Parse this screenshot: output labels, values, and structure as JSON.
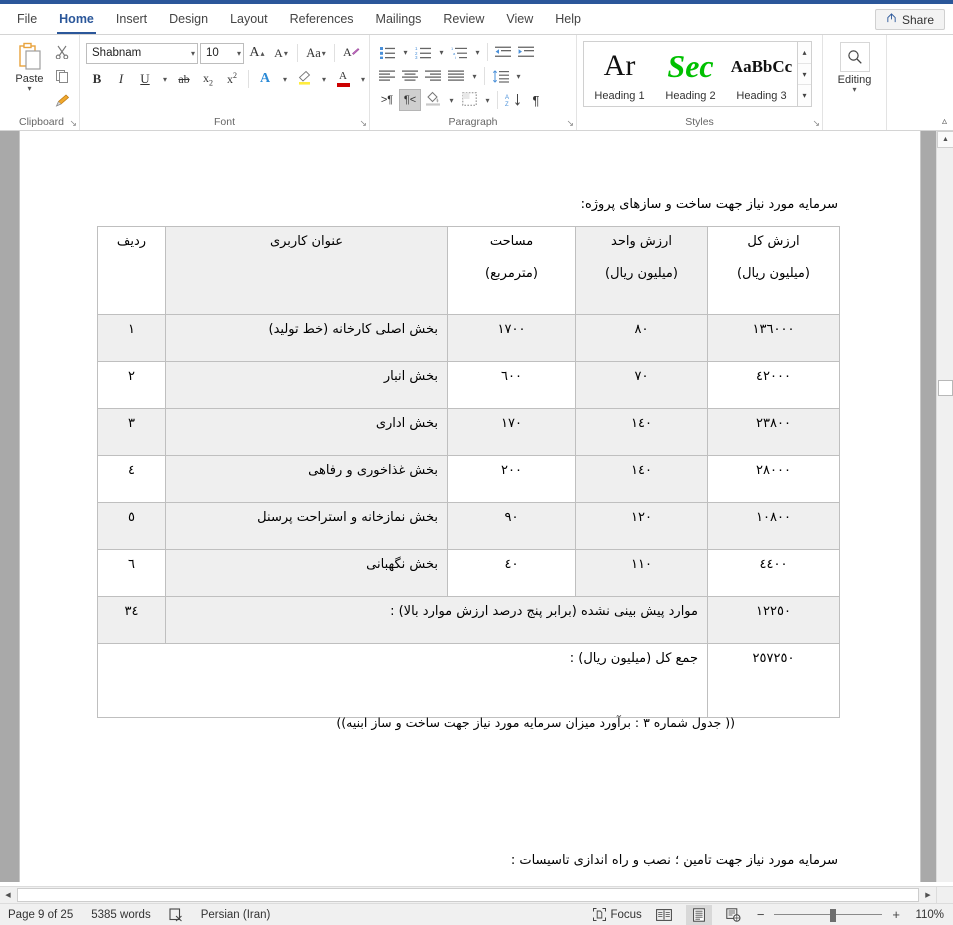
{
  "window": {
    "accent_color": "#2b579a"
  },
  "tabs": [
    {
      "label": "File",
      "active": false
    },
    {
      "label": "Home",
      "active": true
    },
    {
      "label": "Insert",
      "active": false
    },
    {
      "label": "Design",
      "active": false
    },
    {
      "label": "Layout",
      "active": false
    },
    {
      "label": "References",
      "active": false
    },
    {
      "label": "Mailings",
      "active": false
    },
    {
      "label": "Review",
      "active": false
    },
    {
      "label": "View",
      "active": false
    },
    {
      "label": "Help",
      "active": false
    }
  ],
  "share": {
    "label": "Share"
  },
  "ribbon": {
    "clipboard": {
      "label": "Clipboard",
      "paste_label": "Paste",
      "cut_title": "Cut",
      "copy_title": "Copy",
      "format_painter_title": "Format Painter"
    },
    "font": {
      "label": "Font",
      "font_name": "Shabnam",
      "font_size": "10",
      "grow_font": "A",
      "shrink_font": "A",
      "change_case": "Aa",
      "clear_formatting": "A",
      "bold": "B",
      "italic": "I",
      "underline": "U",
      "strikethrough": "ab",
      "subscript": "x",
      "subscript_idx": "2",
      "superscript": "x",
      "superscript_idx": "2",
      "text_effects": "A",
      "highlight": "A",
      "font_color": "A"
    },
    "paragraph": {
      "label": "Paragraph",
      "bullets_title": "Bullets",
      "numbering_title": "Numbering",
      "multilevel_title": "Multilevel List",
      "decrease_indent_title": "Decrease Indent",
      "increase_indent_title": "Increase Indent",
      "align_left_title": "Align Left",
      "center_title": "Center",
      "align_right_title": "Align Right",
      "justify_title": "Justify",
      "line_spacing_title": "Line and Paragraph Spacing",
      "ltr_title": "Left-to-Right Text Direction",
      "rtl_title": "Right-to-Left Text Direction",
      "shading_title": "Shading",
      "borders_title": "Borders",
      "sort_title": "Sort",
      "marks_title": "Show/Hide Formatting Marks",
      "pilcrow": "¶"
    },
    "styles": {
      "label": "Styles",
      "items": [
        {
          "preview": "Ar",
          "name": "Heading 1"
        },
        {
          "preview": "Sec",
          "name": "Heading 2"
        },
        {
          "preview": "AaBbCc",
          "name": "Heading 3"
        }
      ]
    },
    "editing": {
      "label": "Editing",
      "find_title": "Find"
    }
  },
  "document": {
    "intro_text": "سرمایه مورد نیاز جهت ساخت و سازهای پروژه:",
    "caption_text": "(( جدول شماره ٣ : برآورد میزان سرمایه مورد نیاز جهت ساخت و ساز ابنیه))",
    "bottom_text": "سرمایه مورد نیاز جهت تامین ؛ نصب و راه اندازی تاسیسات :",
    "table": {
      "headers": {
        "radif": "ردیف",
        "title": "عنوان کاربری",
        "area_l1": "مساحت",
        "area_l2": "(مترمربع)",
        "unit_l1": "ارزش واحد",
        "unit_l2": "(میلیون ریال)",
        "total_l1": "ارزش کل",
        "total_l2": "(میلیون ریال)"
      },
      "rows": [
        {
          "radif": "١",
          "title": "بخش اصلی کارخانه (خط تولید)",
          "area": "١٧٠٠",
          "unit": "٨٠",
          "total": "١٣٦٠٠٠"
        },
        {
          "radif": "٢",
          "title": "بخش انبار",
          "area": "٦٠٠",
          "unit": "٧٠",
          "total": "٤٢٠٠٠"
        },
        {
          "radif": "٣",
          "title": "بخش اداری",
          "area": "١٧٠",
          "unit": "١٤٠",
          "total": "٢٣٨٠٠"
        },
        {
          "radif": "٤",
          "title": "بخش غذاخوری و رفاهی",
          "area": "٢٠٠",
          "unit": "١٤٠",
          "total": "٢٨٠٠٠"
        },
        {
          "radif": "٥",
          "title": "بخش نمازخانه و استراحت پرسنل",
          "area": "٩٠",
          "unit": "١٢٠",
          "total": "١٠٨٠٠"
        },
        {
          "radif": "٦",
          "title": "بخش نگهبانی",
          "area": "٤٠",
          "unit": "١١٠",
          "total": "٤٤٠٠"
        }
      ],
      "extra_row": {
        "radif": "٣٤",
        "title": "موارد پیش بینی نشده (برابر پنج درصد ارزش موارد بالا) :",
        "total": "١٢٢٥٠"
      },
      "sum_row": {
        "label": "جمع کل (میلیون ریال) :",
        "total": "٢٥٧٢٥٠"
      }
    }
  },
  "status_bar": {
    "page": "Page 9 of 25",
    "words": "5385 words",
    "proofing_title": "Proofing errors",
    "language": "Persian (Iran)",
    "focus": "Focus",
    "read_mode_title": "Read Mode",
    "print_layout_title": "Print Layout",
    "web_layout_title": "Web Layout",
    "zoom_out": "−",
    "zoom_in": "+",
    "zoom_level": "110%"
  }
}
